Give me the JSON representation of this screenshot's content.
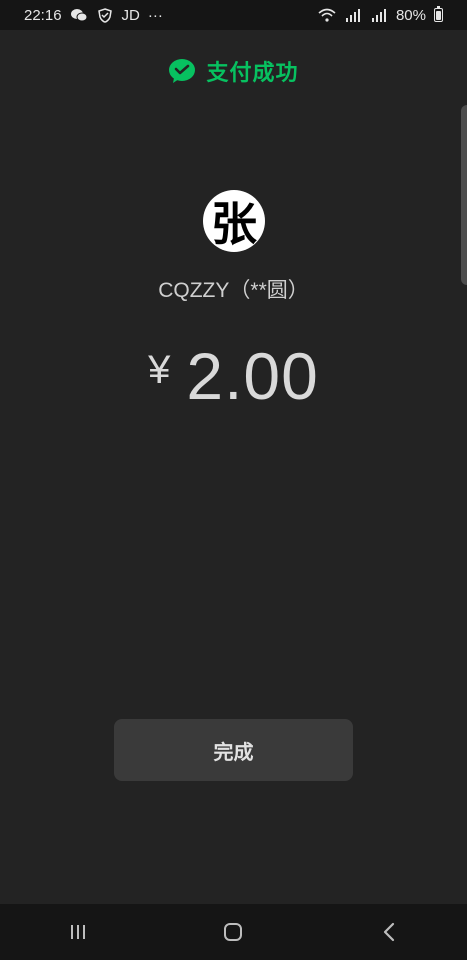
{
  "status_bar": {
    "time": "22:16",
    "carrier_text": "JD",
    "more": "···",
    "battery": "80%",
    "icons": [
      "wechat-icon",
      "shield-icon",
      "wifi-icon",
      "signal-icon",
      "signal-icon",
      "battery-icon"
    ]
  },
  "header": {
    "title": "支付成功",
    "accent_color": "#07c160"
  },
  "merchant": {
    "avatar_char": "张",
    "name": "CQZZY（**圆）"
  },
  "amount": {
    "currency": "¥",
    "value": "2.00"
  },
  "done_button": {
    "label": "完成"
  },
  "navigation": {
    "items": [
      "recents-icon",
      "home-icon",
      "back-icon"
    ]
  }
}
